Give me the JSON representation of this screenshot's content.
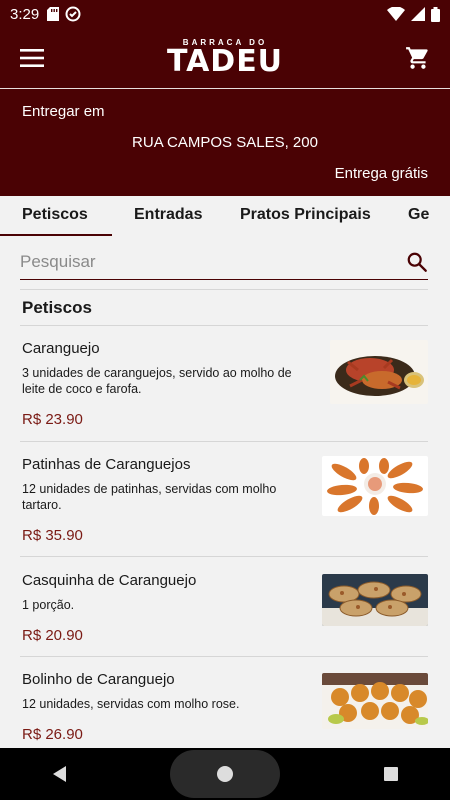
{
  "status": {
    "time": "3:29"
  },
  "brand": {
    "small": "BARRACA DO",
    "big": "TADEU"
  },
  "delivery": {
    "label": "Entregar em",
    "address": "RUA CAMPOS SALES, 200",
    "free": "Entrega grátis"
  },
  "tabs": [
    "Petiscos",
    "Entradas",
    "Pratos Principais",
    "Ge"
  ],
  "search": {
    "placeholder": "Pesquisar"
  },
  "section": {
    "title": "Petiscos"
  },
  "items": [
    {
      "name": "Caranguejo",
      "desc": "3 unidades de caranguejos, servido ao molho de leite de coco e farofa.",
      "price": "R$ 23.90",
      "image": "crab-dish-image"
    },
    {
      "name": "Patinhas de Caranguejos",
      "desc": "12 unidades de patinhas, servidas com molho tartaro.",
      "price": "R$ 35.90",
      "image": "crab-claws-image"
    },
    {
      "name": "Casquinha de Caranguejo",
      "desc": "1 porção.",
      "price": "R$ 20.90",
      "image": "crab-shells-image"
    },
    {
      "name": "Bolinho de Caranguejo",
      "desc": "12 unidades, servidas com molho rose.",
      "price": "R$ 26.90",
      "image": "crab-balls-image"
    }
  ],
  "colors": {
    "primary": "#4a0204",
    "price": "#7a1a14",
    "background": "#f2f2f2"
  }
}
